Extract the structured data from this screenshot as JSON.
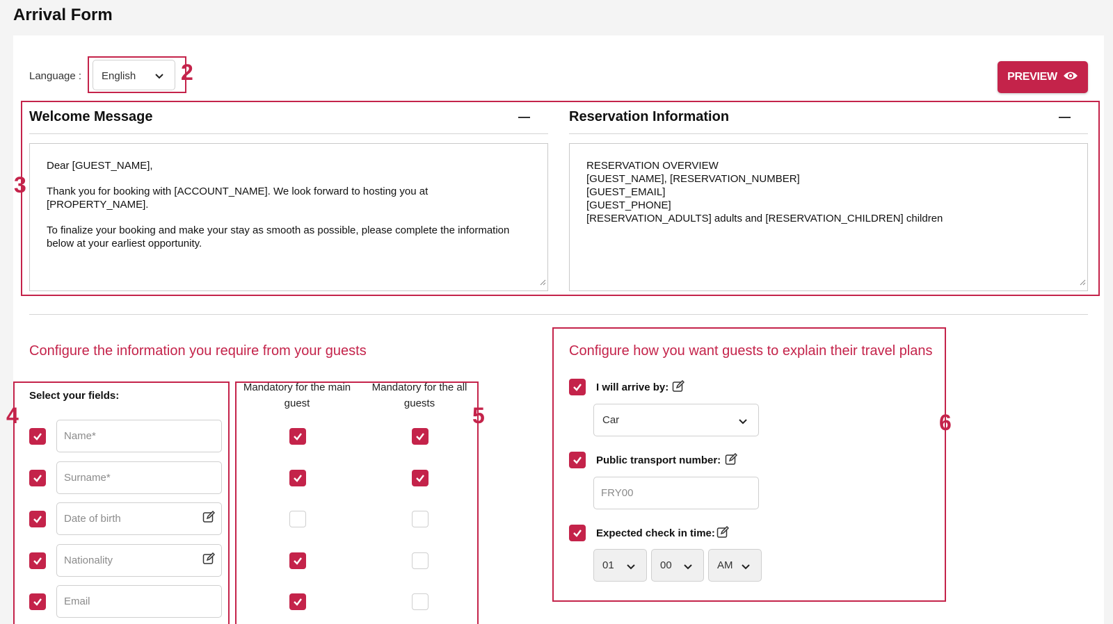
{
  "page": {
    "title": "Arrival Form"
  },
  "language": {
    "label": "Language :",
    "value": "English"
  },
  "preview_button": {
    "label": "PREVIEW"
  },
  "callouts": {
    "c2": "2",
    "c3": "3",
    "c4": "4",
    "c5": "5",
    "c6": "6"
  },
  "welcome": {
    "title": "Welcome Message",
    "paragraphs": [
      "Dear [GUEST_NAME],",
      "Thank you for booking with [ACCOUNT_NAME]. We look forward to hosting you at [PROPERTY_NAME].",
      "To finalize your booking and make your stay as smooth as possible, please complete the information below at your earliest opportunity."
    ]
  },
  "reservation": {
    "title": "Reservation Information",
    "lines": [
      "RESERVATION OVERVIEW",
      "[GUEST_NAME], [RESERVATION_NUMBER]",
      "[GUEST_EMAIL]",
      "[GUEST_PHONE]",
      "[RESERVATION_ADULTS] adults and [RESERVATION_CHILDREN] children"
    ]
  },
  "guest_info": {
    "title": "Configure the information you require from your guests",
    "select_label": "Select your fields:",
    "col_main": "Mandatory for the main guest",
    "col_all": "Mandatory for the all guests",
    "fields": [
      {
        "placeholder": "Name*",
        "enabled": true,
        "editable": false,
        "main": true,
        "all": true
      },
      {
        "placeholder": "Surname*",
        "enabled": true,
        "editable": false,
        "main": true,
        "all": true
      },
      {
        "placeholder": "Date of birth",
        "enabled": true,
        "editable": true,
        "main": false,
        "all": false
      },
      {
        "placeholder": "Nationality",
        "enabled": true,
        "editable": true,
        "main": true,
        "all": false
      },
      {
        "placeholder": "Email",
        "enabled": true,
        "editable": false,
        "main": true,
        "all": false
      }
    ]
  },
  "travel": {
    "title": "Configure how you want guests to explain their travel plans",
    "arrive_label": "I will arrive by:",
    "arrive_value": "Car",
    "transport_label": "Public transport number:",
    "transport_placeholder": "FRY00",
    "checkin_label": "Expected check in time:",
    "hour": "01",
    "minute": "00",
    "ampm": "AM"
  },
  "colors": {
    "accent": "#c4234a"
  }
}
